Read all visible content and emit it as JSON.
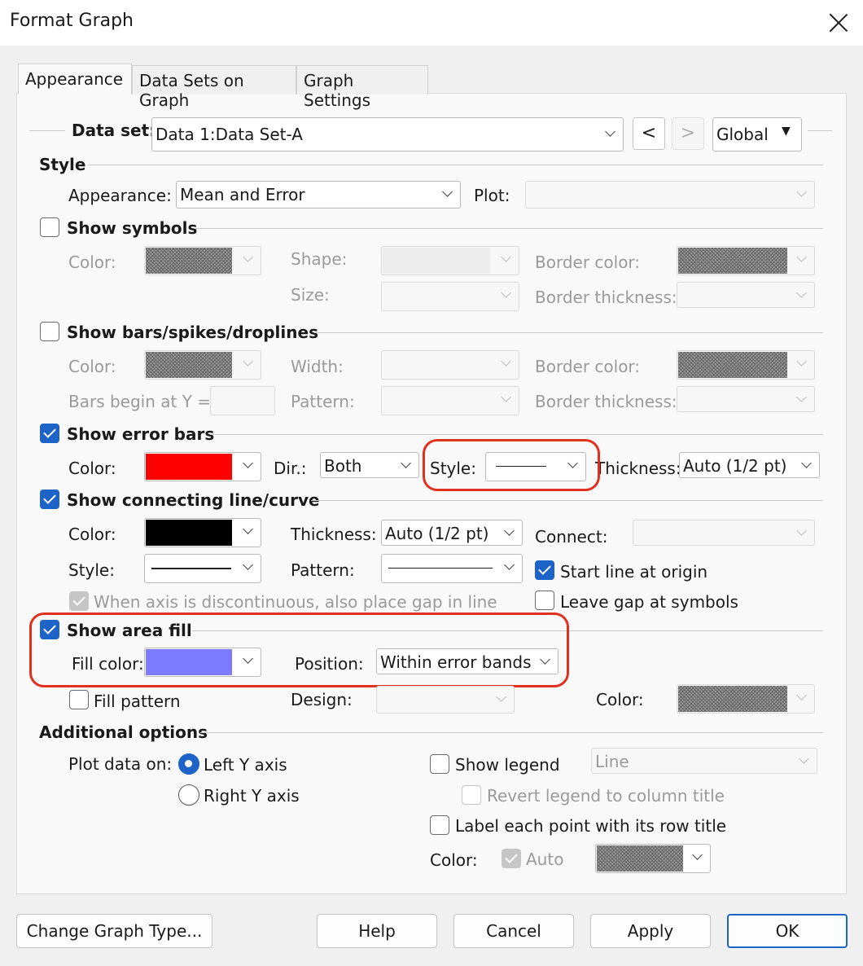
{
  "window": {
    "title": "Format Graph"
  },
  "tabs": [
    {
      "label": "Appearance",
      "active": true
    },
    {
      "label": "Data Sets on Graph",
      "active": false
    },
    {
      "label": "Graph Settings",
      "active": false
    }
  ],
  "dataset": {
    "label": "Data set:",
    "value": "Data 1:Data Set-A",
    "prev_label": "<",
    "next_label": ">",
    "scope_value": "Global"
  },
  "style": {
    "heading": "Style",
    "appearance_label": "Appearance:",
    "appearance_value": "Mean and Error",
    "plot_label": "Plot:",
    "plot_value": ""
  },
  "symbols": {
    "heading": "Show symbols",
    "checked": false,
    "color_label": "Color:",
    "shape_label": "Shape:",
    "size_label": "Size:",
    "border_color_label": "Border color:",
    "border_thickness_label": "Border thickness:"
  },
  "bars": {
    "heading": "Show bars/spikes/droplines",
    "checked": false,
    "color_label": "Color:",
    "width_label": "Width:",
    "border_color_label": "Border color:",
    "bars_begin_label": "Bars begin at Y =",
    "pattern_label": "Pattern:",
    "border_thickness_label": "Border thickness:"
  },
  "error_bars": {
    "heading": "Show error bars",
    "checked": true,
    "color_label": "Color:",
    "color": "#ff0000",
    "dir_label": "Dir.:",
    "dir_value": "Both",
    "style_label": "Style:",
    "thickness_label": "Thickness:",
    "thickness_value": "Auto (1/2 pt)"
  },
  "connecting_line": {
    "heading": "Show connecting line/curve",
    "checked": true,
    "color_label": "Color:",
    "color": "#000000",
    "thickness_label": "Thickness:",
    "thickness_value": "Auto (1/2 pt)",
    "connect_label": "Connect:",
    "style_label": "Style:",
    "pattern_label": "Pattern:",
    "start_at_origin_label": "Start line at origin",
    "start_at_origin_checked": true,
    "gap_discontinuous_label": "When axis is discontinuous, also place gap in line",
    "leave_gap_label": "Leave gap at symbols",
    "leave_gap_checked": false
  },
  "area_fill": {
    "heading": "Show area fill",
    "checked": true,
    "fill_color_label": "Fill color:",
    "fill_color": "#7b7bff",
    "position_label": "Position:",
    "position_value": "Within error bands",
    "fill_pattern_label": "Fill pattern",
    "fill_pattern_checked": false,
    "design_label": "Design:",
    "color_label": "Color:"
  },
  "additional": {
    "heading": "Additional options",
    "plot_on_label": "Plot data on:",
    "left_axis_label": "Left Y axis",
    "right_axis_label": "Right  Y axis",
    "selected_axis": "left",
    "show_legend_label": "Show legend",
    "legend_value": "Line",
    "revert_legend_label": "Revert legend to column title",
    "label_points_label": "Label each point with its row title",
    "color_label": "Color:",
    "auto_label": "Auto"
  },
  "buttons": {
    "change_graph_type": "Change Graph Type...",
    "help": "Help",
    "cancel": "Cancel",
    "apply": "Apply",
    "ok": "OK"
  },
  "highlight_color": "#e0301e"
}
